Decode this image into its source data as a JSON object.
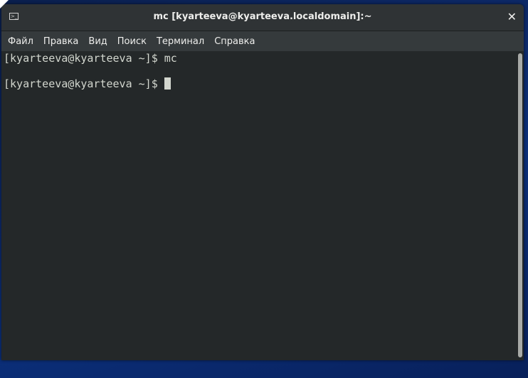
{
  "window": {
    "title": "mc [kyarteeva@kyarteeva.localdomain]:~",
    "close_icon": "close-icon",
    "app_icon": "terminal-icon"
  },
  "menu": [
    "Файл",
    "Правка",
    "Вид",
    "Поиск",
    "Терминал",
    "Справка"
  ],
  "terminal": {
    "lines": [
      "[kyarteeva@kyarteeva ~]$ mc",
      "",
      "[kyarteeva@kyarteeva ~]$ "
    ]
  }
}
